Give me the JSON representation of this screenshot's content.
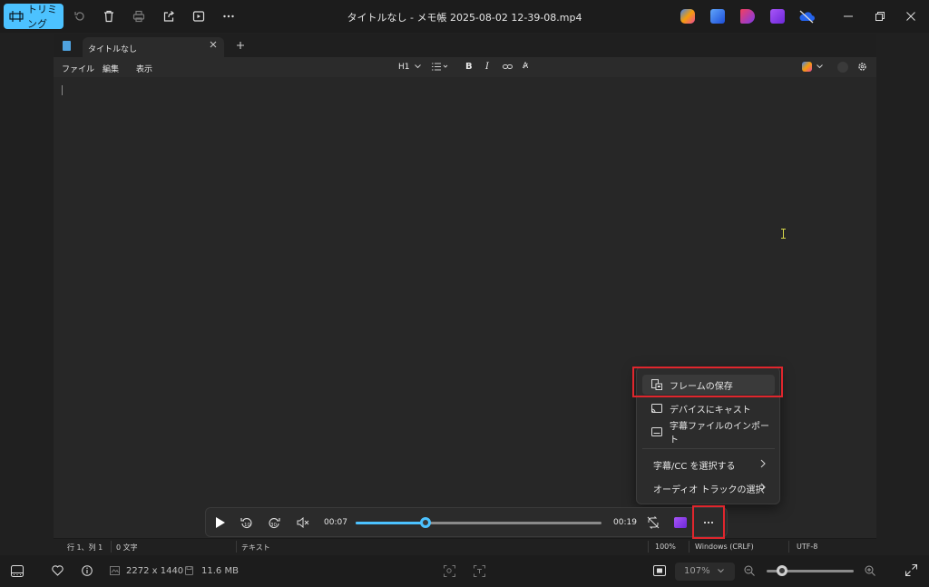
{
  "topbar": {
    "trim_label": "トリミング",
    "title": "タイトルなし - メモ帳 2025-08-02 12-39-08.mp4"
  },
  "notepad": {
    "tab_title": "タイトルなし",
    "menu": [
      "ファイル",
      "編集",
      "表示"
    ],
    "heading_label": "H1",
    "status": {
      "position": "行 1、列 1",
      "chars": "0 文字",
      "mode": "テキスト",
      "zoom": "100%",
      "line_ending": "Windows (CRLF)",
      "encoding": "UTF-8"
    }
  },
  "context_menu": {
    "items": [
      {
        "label": "フレームの保存",
        "icon": "save-frame-icon"
      },
      {
        "label": "デバイスにキャスト",
        "icon": "cast-icon"
      },
      {
        "label": "字幕ファイルのインポート",
        "icon": "subtitle-icon"
      },
      {
        "label": "字幕/CC を選択する",
        "icon": "chevron-right-icon"
      },
      {
        "label": "オーディオ トラックの選択",
        "icon": "chevron-right-icon"
      }
    ]
  },
  "player": {
    "current_time": "00:07",
    "total_time": "00:19",
    "progress_fraction": 0.285
  },
  "bottombar": {
    "dimensions": "2272 x 1440",
    "file_size": "11.6 MB",
    "zoom": "107%",
    "zoom_fraction": 0.18
  },
  "colors": {
    "accent": "#4cc2ff",
    "highlight_box": "#e0262d"
  }
}
